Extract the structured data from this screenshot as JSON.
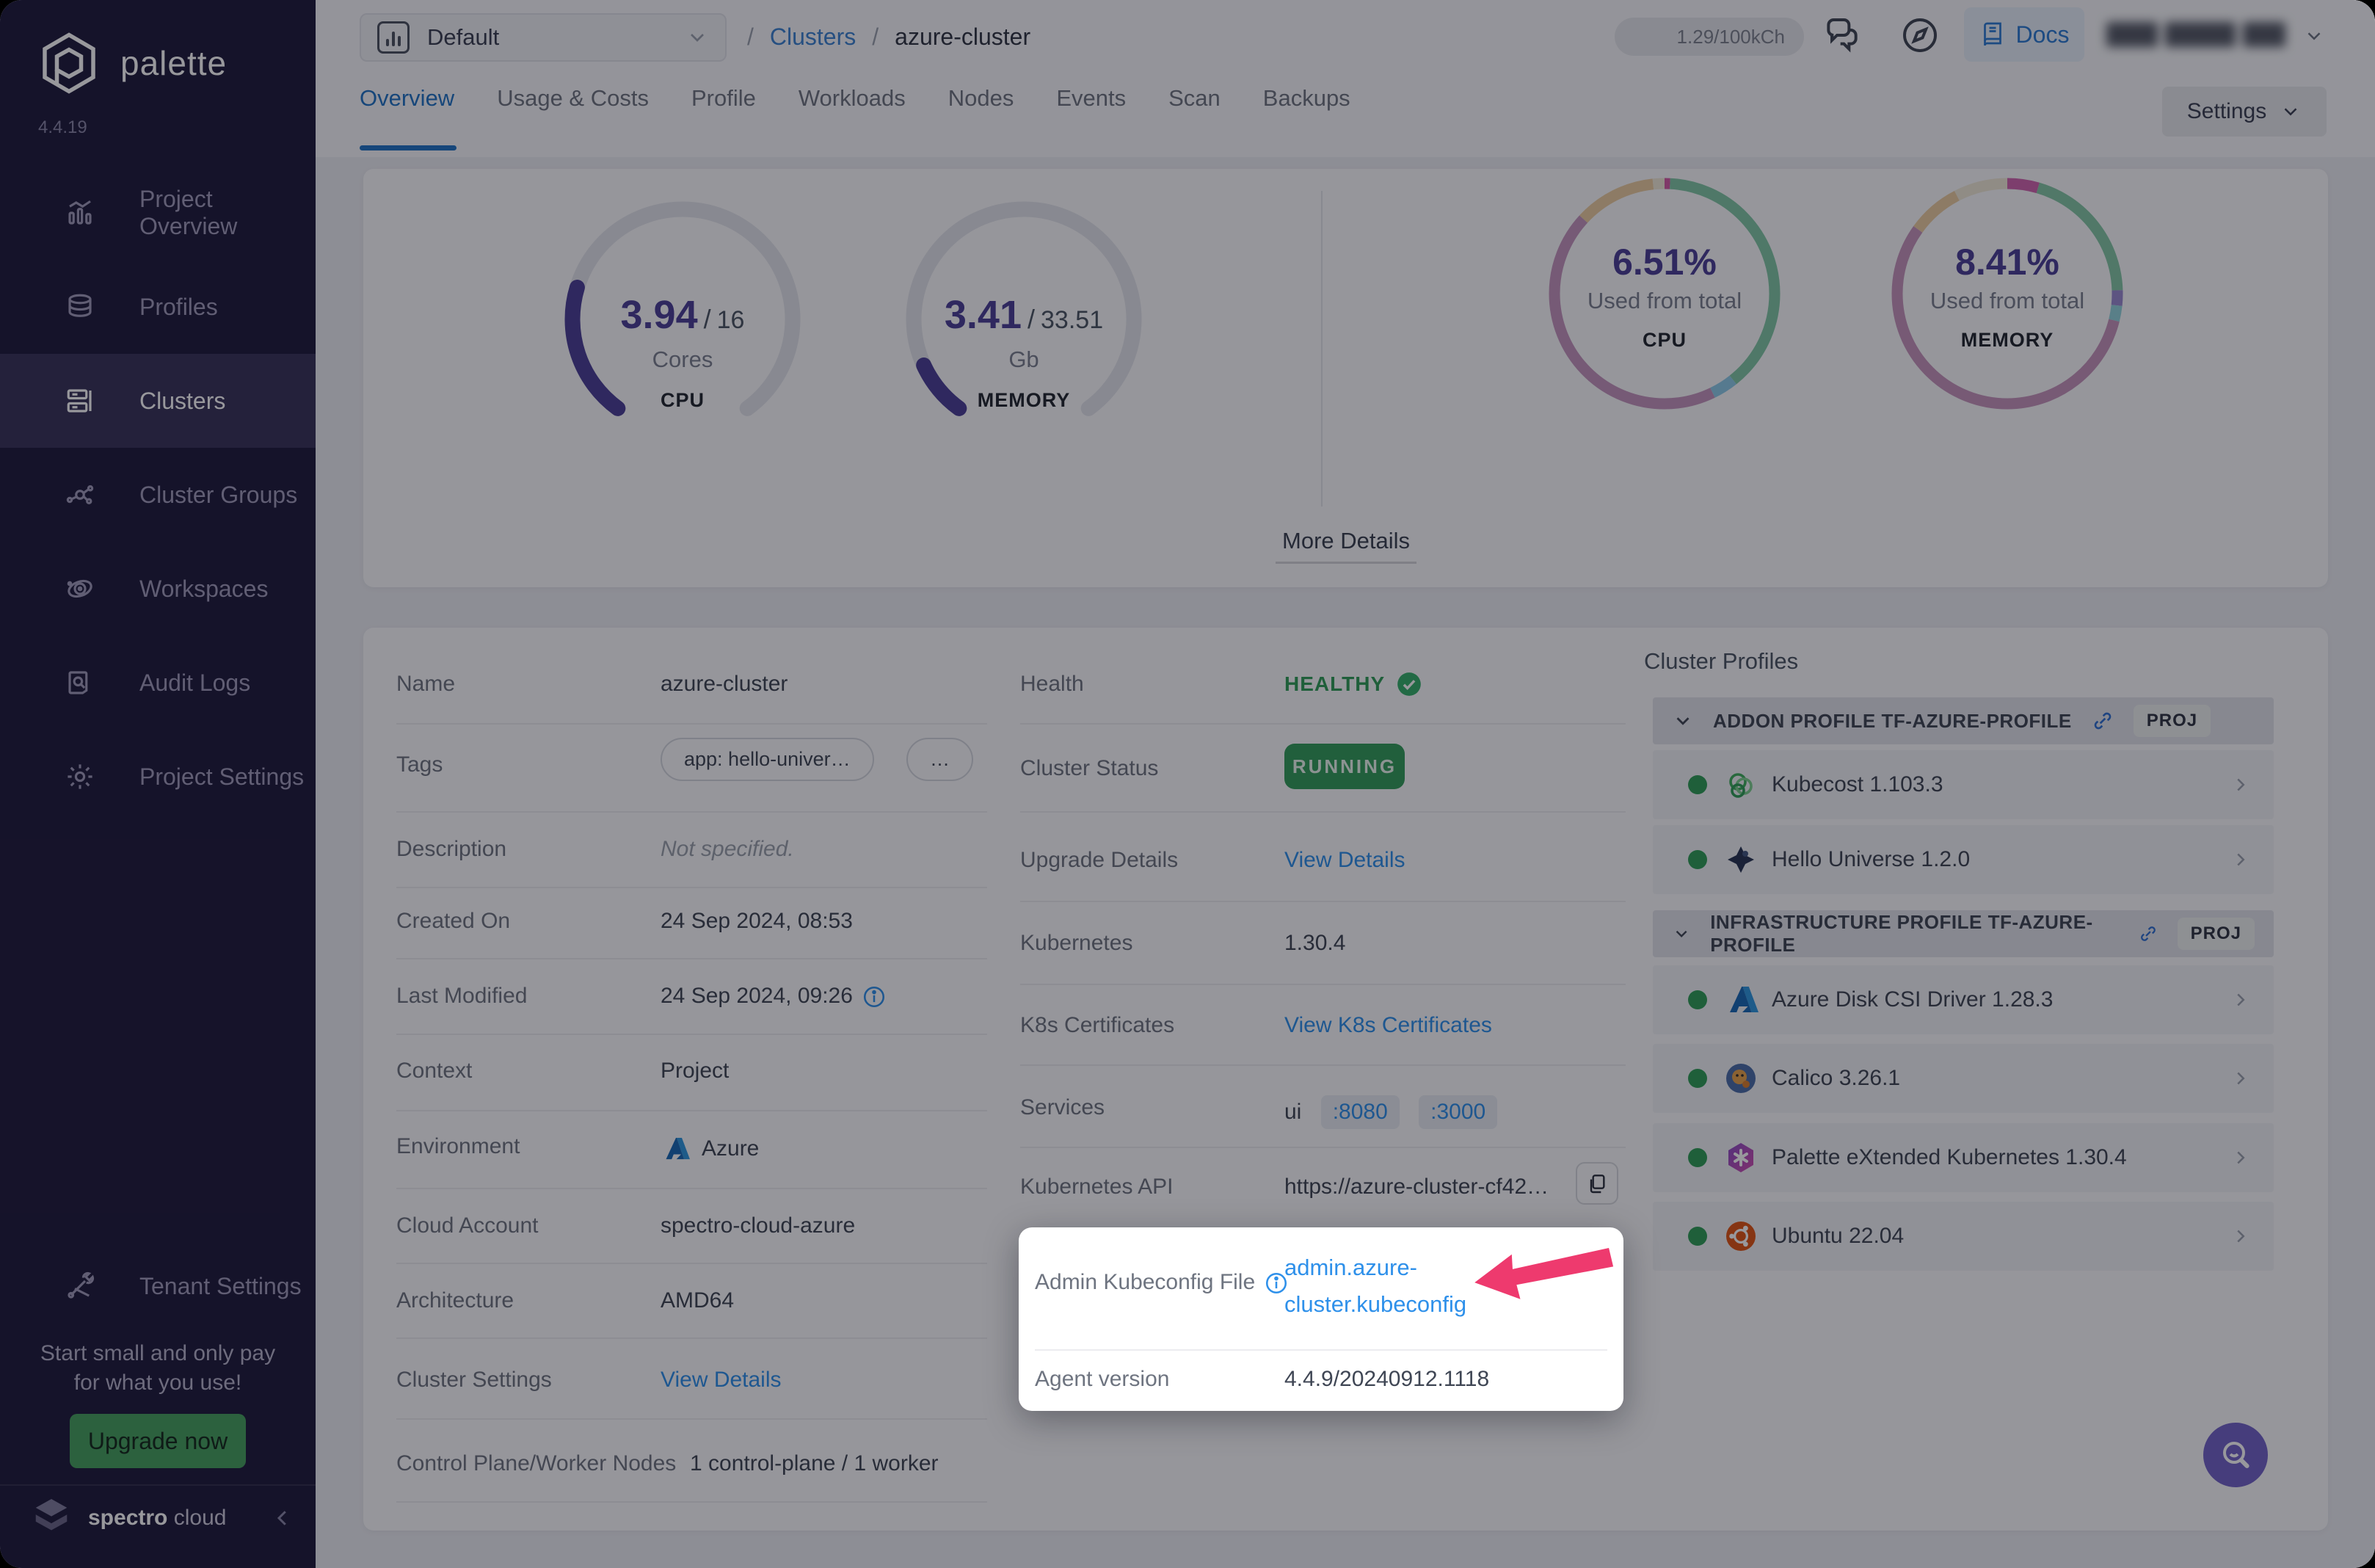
{
  "sidebar": {
    "logo_text": "palette",
    "version": "4.4.19",
    "items": [
      {
        "label": "Project Overview"
      },
      {
        "label": "Profiles"
      },
      {
        "label": "Clusters"
      },
      {
        "label": "Cluster Groups"
      },
      {
        "label": "Workspaces"
      },
      {
        "label": "Audit Logs"
      },
      {
        "label": "Project Settings"
      }
    ],
    "tenant_settings": "Tenant Settings",
    "promo_line1": "Start small and only pay",
    "promo_line2": "for what you use!",
    "upgrade_cta": "Upgrade now",
    "brand_bold": "spectro",
    "brand_light": "cloud"
  },
  "topbar": {
    "project_selector": "Default",
    "breadcrumb_sep": "/",
    "breadcrumb_link": "Clusters",
    "breadcrumb_current": "azure-cluster",
    "usage_pill": "1.29/100kCh",
    "docs_label": "Docs"
  },
  "tabs": {
    "items": [
      {
        "label": "Overview"
      },
      {
        "label": "Usage & Costs"
      },
      {
        "label": "Profile"
      },
      {
        "label": "Workloads"
      },
      {
        "label": "Nodes"
      },
      {
        "label": "Events"
      },
      {
        "label": "Scan"
      },
      {
        "label": "Backups"
      }
    ],
    "settings_label": "Settings"
  },
  "overview": {
    "gauges": [
      {
        "id": "gauge-cpu",
        "used": "3.94",
        "separator": "/",
        "total": "16",
        "unit": "Cores",
        "label": "CPU",
        "fraction": 0.246
      },
      {
        "id": "gauge-memory",
        "used": "3.41",
        "separator": "/",
        "total": "33.51",
        "unit": "Gb",
        "label": "MEMORY",
        "fraction": 0.102
      }
    ],
    "donuts": [
      {
        "id": "donut-cpu",
        "pct": "6.51%",
        "caption": "Used from total",
        "label": "CPU",
        "segments": [
          {
            "color": "#d65ba6",
            "frac": 0.008
          },
          {
            "color": "#82c8a5",
            "frac": 0.385
          },
          {
            "color": "#8ecbe8",
            "frac": 0.035
          },
          {
            "color": "#c495bd",
            "frac": 0.44
          },
          {
            "color": "#eccda0",
            "frac": 0.115
          },
          {
            "color": "#f2ead8",
            "frac": 0.017
          }
        ]
      },
      {
        "id": "donut-memory",
        "pct": "8.41%",
        "caption": "Used from total",
        "label": "MEMORY",
        "segments": [
          {
            "color": "#d065ae",
            "frac": 0.045
          },
          {
            "color": "#85c8a6",
            "frac": 0.2
          },
          {
            "color": "#9a8ad1",
            "frac": 0.022
          },
          {
            "color": "#93d4dd",
            "frac": 0.022
          },
          {
            "color": "#c794bc",
            "frac": 0.56
          },
          {
            "color": "#eccda0",
            "frac": 0.075
          },
          {
            "color": "#f2ead8",
            "frac": 0.076
          }
        ]
      }
    ],
    "gauge_track_color": "#e4e5ec",
    "gauge_progress_color": "#4a3f97",
    "more_details": "More Details"
  },
  "details": {
    "name_label": "Name",
    "name_value": "azure-cluster",
    "tags_label": "Tags",
    "tag1": "app: hello-univer…",
    "tag2": "…",
    "description_label": "Description",
    "description_value": "Not specified.",
    "created_label": "Created On",
    "created_value": "24 Sep 2024, 08:53",
    "modified_label": "Last Modified",
    "modified_value": "24 Sep 2024, 09:26",
    "context_label": "Context",
    "context_value": "Project",
    "environment_label": "Environment",
    "environment_value": "Azure",
    "cloud_label": "Cloud Account",
    "cloud_value": "spectro-cloud-azure",
    "arch_label": "Architecture",
    "arch_value": "AMD64",
    "cluster_settings_label": "Cluster Settings",
    "cluster_settings_link": "View Details",
    "nodes_label": "Control Plane/Worker Nodes",
    "nodes_value": "1 control-plane / 1 worker"
  },
  "status": {
    "health_label": "Health",
    "health_value": "HEALTHY",
    "cluster_status_label": "Cluster Status",
    "cluster_status_value": "RUNNING",
    "upgrade_label": "Upgrade Details",
    "upgrade_link": "View Details",
    "kubernetes_label": "Kubernetes",
    "kubernetes_value": "1.30.4",
    "certs_label": "K8s Certificates",
    "certs_link": "View K8s Certificates",
    "services_label": "Services",
    "services_prefix": "ui",
    "service_port1": ":8080",
    "service_port2": ":3000",
    "api_label": "Kubernetes API",
    "api_value": "https://azure-cluster-cf42…",
    "kubeconfig_label": "Admin Kubeconfig File",
    "kubeconfig_link": "admin.azure-cluster.kubeconfig",
    "agent_label": "Agent version",
    "agent_value": "4.4.9/20240912.1118"
  },
  "profiles": {
    "title": "Cluster Profiles",
    "sections": [
      {
        "title": "ADDON PROFILE TF-AZURE-PROFILE",
        "badge": "PROJ",
        "items": [
          {
            "name": "Kubecost 1.103.3"
          },
          {
            "name": "Hello Universe 1.2.0"
          }
        ]
      },
      {
        "title": "INFRASTRUCTURE PROFILE TF-AZURE-PROFILE",
        "badge": "PROJ",
        "items": [
          {
            "name": "Azure Disk CSI Driver 1.28.3"
          },
          {
            "name": "Calico 3.26.1"
          },
          {
            "name": "Palette eXtended Kubernetes 1.30.4"
          },
          {
            "name": "Ubuntu 22.04"
          }
        ]
      }
    ]
  },
  "colors": {
    "accent_blue": "#2e90ea",
    "green": "#2f9e57",
    "indigo": "#4a3f97",
    "arrow_pink": "#ee3a6e"
  }
}
